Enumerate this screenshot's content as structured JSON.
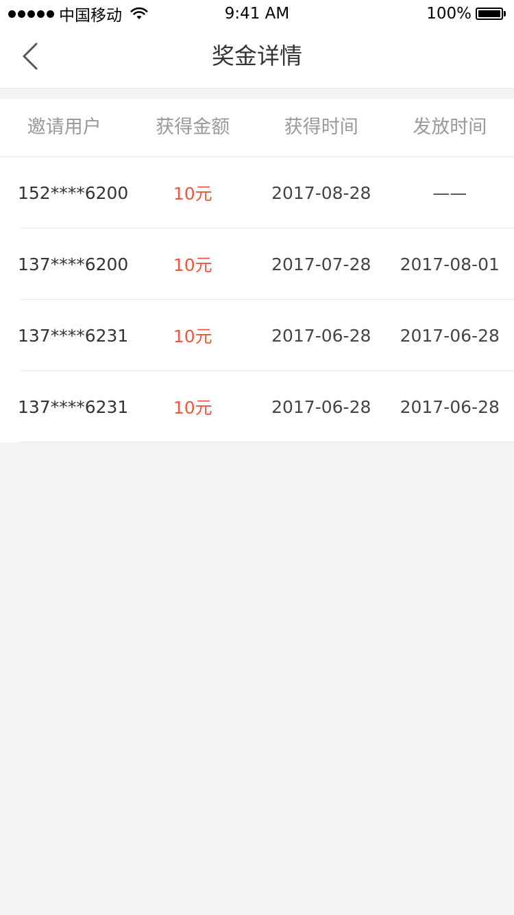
{
  "status_bar": {
    "carrier": "中国移动",
    "time": "9:41 AM",
    "battery": "100%",
    "signal_icon": "signal-dots-icon",
    "wifi_icon": "wifi-icon",
    "battery_icon": "battery-icon"
  },
  "nav": {
    "title": "奖金详情",
    "back_icon": "back-chevron-icon"
  },
  "table": {
    "columns": [
      "邀请用户",
      "获得金额",
      "获得时间",
      "发放时间"
    ],
    "rows": [
      {
        "user": "152****6200",
        "amount": "10元",
        "earned": "2017-08-28",
        "paid": "——"
      },
      {
        "user": "137****6200",
        "amount": "10元",
        "earned": "2017-07-28",
        "paid": "2017-08-01"
      },
      {
        "user": "137****6231",
        "amount": "10元",
        "earned": "2017-06-28",
        "paid": "2017-06-28"
      },
      {
        "user": "137****6231",
        "amount": "10元",
        "earned": "2017-06-28",
        "paid": "2017-06-28"
      }
    ]
  },
  "colors": {
    "accent_amount": "#f0553b",
    "background": "#f4f4f4",
    "header_text": "#999999",
    "body_text": "#333333"
  }
}
